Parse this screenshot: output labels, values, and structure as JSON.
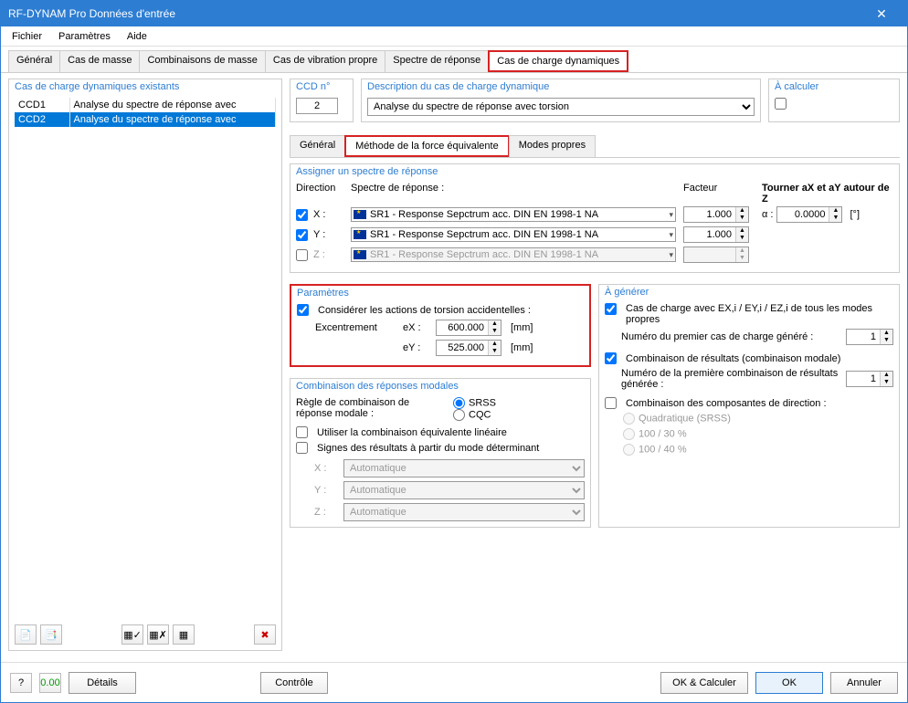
{
  "window": {
    "title": "RF-DYNAM Pro Données d'entrée"
  },
  "menubar": [
    "Fichier",
    "Paramètres",
    "Aide"
  ],
  "main_tabs": [
    "Général",
    "Cas de masse",
    "Combinaisons de masse",
    "Cas de vibration propre",
    "Spectre de réponse",
    "Cas de charge dynamiques"
  ],
  "main_tab_active": 5,
  "existing": {
    "title": "Cas de charge dynamiques existants",
    "rows": [
      {
        "id": "CCD1",
        "desc": "Analyse du spectre de réponse avec"
      },
      {
        "id": "CCD2",
        "desc": "Analyse du spectre de réponse avec"
      }
    ],
    "selected": 1
  },
  "ccd_no": {
    "title": "CCD n°",
    "value": "2"
  },
  "description": {
    "title": "Description du cas de charge dynamique",
    "value": "Analyse du spectre de réponse avec torsion"
  },
  "calc": {
    "title": "À calculer",
    "checked": false
  },
  "sub_tabs": [
    "Général",
    "Méthode de la force équivalente",
    "Modes propres"
  ],
  "sub_tab_active": 1,
  "assign": {
    "title": "Assigner un spectre de réponse",
    "h_direction": "Direction",
    "h_spectrum": "Spectre de réponse :",
    "h_factor": "Facteur",
    "h_rotate": "Tourner aX et aY autour de Z",
    "alpha_label": "α :",
    "alpha_value": "0.0000",
    "alpha_unit": "[°]",
    "rows": [
      {
        "dir": "X :",
        "checked": true,
        "spectrum": "SR1 - Response Sepctrum acc. DIN EN 1998-1 NA",
        "factor": "1.000",
        "enabled": true
      },
      {
        "dir": "Y :",
        "checked": true,
        "spectrum": "SR1 - Response Sepctrum acc. DIN EN 1998-1 NA",
        "factor": "1.000",
        "enabled": true
      },
      {
        "dir": "Z :",
        "checked": false,
        "spectrum": "SR1 - Response Sepctrum acc. DIN EN 1998-1 NA",
        "factor": "",
        "enabled": false
      }
    ]
  },
  "params": {
    "title": "Paramètres",
    "torsion_label": "Considérer les actions de torsion accidentelles :",
    "torsion_checked": true,
    "ecc_label": "Excentrement",
    "ex_label": "eX :",
    "ex_value": "600.000",
    "unit_mm": "[mm]",
    "ey_label": "eY :",
    "ey_value": "525.000"
  },
  "modal": {
    "title": "Combinaison des réponses modales",
    "rule_label": "Règle de combinaison de réponse modale :",
    "srss": "SRSS",
    "cqc": "CQC",
    "rule_selected": "SRSS",
    "use_linear": "Utiliser la combinaison équivalente linéaire",
    "signs": "Signes des résultats à partir du mode déterminant",
    "axes": {
      "x": "X :",
      "y": "Y :",
      "z": "Z :",
      "auto": "Automatique"
    }
  },
  "generate": {
    "title": "À générer",
    "lc_label_full": "Cas de charge avec EX,i / EY,i / EZ,i de tous les modes propres",
    "lc_checked": true,
    "first_lc_label": "Numéro du premier cas de charge généré :",
    "first_lc_value": "1",
    "rc_label": "Combinaison de résultats (combinaison modale)",
    "rc_checked": true,
    "first_rc_label": "Numéro de la première combinaison de résultats générée :",
    "first_rc_value": "1",
    "dir_label": "Combinaison des composantes de direction :",
    "dir_checked": false,
    "opt_quad": "Quadratique (SRSS)",
    "opt_10030": "100 / 30 %",
    "opt_10040": "100 / 40 %"
  },
  "footer": {
    "details": "Détails",
    "control": "Contrôle",
    "ok_calc": "OK & Calculer",
    "ok": "OK",
    "cancel": "Annuler"
  }
}
